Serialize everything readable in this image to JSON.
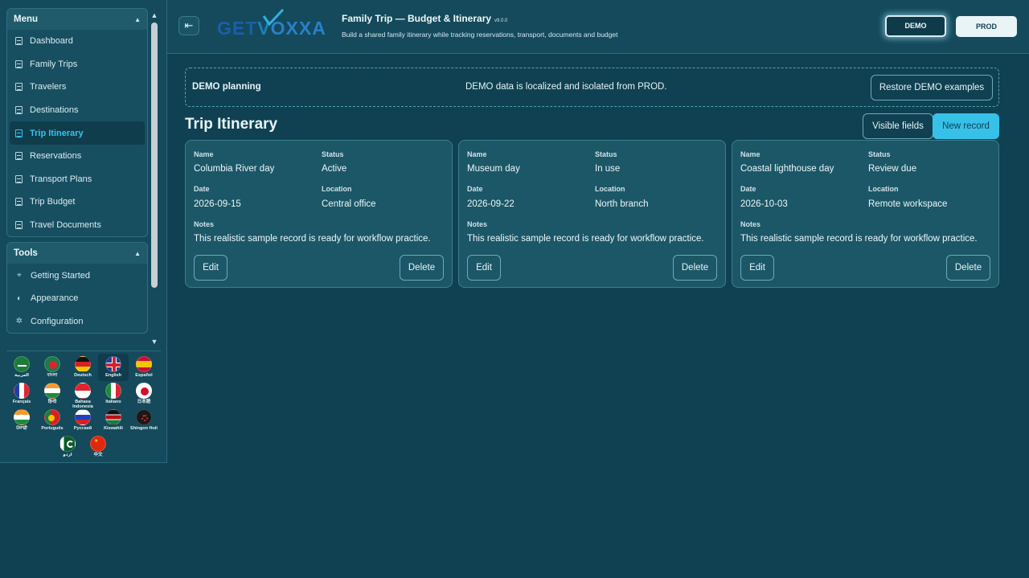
{
  "menu": {
    "title": "Menu",
    "items": [
      {
        "label": "Dashboard",
        "active": false
      },
      {
        "label": "Family Trips",
        "active": false
      },
      {
        "label": "Travelers",
        "active": false
      },
      {
        "label": "Destinations",
        "active": false
      },
      {
        "label": "Trip Itinerary",
        "active": true
      },
      {
        "label": "Reservations",
        "active": false
      },
      {
        "label": "Transport Plans",
        "active": false
      },
      {
        "label": "Trip Budget",
        "active": false
      },
      {
        "label": "Travel Documents",
        "active": false
      }
    ]
  },
  "tools": {
    "title": "Tools",
    "items": [
      {
        "label": "Getting Started",
        "icon": "pointer-icon"
      },
      {
        "label": "Appearance",
        "icon": "palette-icon"
      },
      {
        "label": "Configuration",
        "icon": "gear-icon"
      }
    ]
  },
  "languages": [
    {
      "name": "العربية"
    },
    {
      "name": "বাংলা"
    },
    {
      "name": "Deutsch"
    },
    {
      "name": "English",
      "selected": true
    },
    {
      "name": "Español"
    },
    {
      "name": "Français"
    },
    {
      "name": "हिन्दी"
    },
    {
      "name": "Bahasa Indonesia"
    },
    {
      "name": "Italiano"
    },
    {
      "name": "日本語"
    },
    {
      "name": "ਪੰਜਾਬੀ"
    },
    {
      "name": "Português"
    },
    {
      "name": "Русский"
    },
    {
      "name": "Kiswahili"
    },
    {
      "name": "Shingon Hoii"
    },
    {
      "name": "اردو"
    },
    {
      "name": "中文"
    }
  ],
  "header": {
    "logo": "GETVOXXA",
    "title": "Family Trip — Budget & Itinerary",
    "version": "v9.0.0",
    "subtitle": "Build a shared family itinerary while tracking reservations, transport, documents and budget",
    "env_demo": "DEMO",
    "env_prod": "PROD"
  },
  "banner": {
    "title": "DEMO planning",
    "message": "DEMO data is localized and isolated from PROD.",
    "restore_label": "Restore DEMO examples"
  },
  "page": {
    "title": "Trip Itinerary",
    "visible_fields_label": "Visible fields",
    "new_record_label": "New record"
  },
  "field_labels": {
    "name": "Name",
    "status": "Status",
    "date": "Date",
    "location": "Location",
    "notes": "Notes"
  },
  "card_buttons": {
    "edit": "Edit",
    "delete": "Delete"
  },
  "records": [
    {
      "name": "Columbia River day",
      "status": "Active",
      "date": "2026-09-15",
      "location": "Central office",
      "notes": "This realistic sample record is ready for workflow practice."
    },
    {
      "name": "Museum day",
      "status": "In use",
      "date": "2026-09-22",
      "location": "North branch",
      "notes": "This realistic sample record is ready for workflow practice."
    },
    {
      "name": "Coastal lighthouse day",
      "status": "Review due",
      "date": "2026-10-03",
      "location": "Remote workspace",
      "notes": "This realistic sample record is ready for workflow practice."
    }
  ],
  "colors": {
    "background": "#0f4152",
    "panel": "#144a5b",
    "accent": "#36c1e8"
  }
}
